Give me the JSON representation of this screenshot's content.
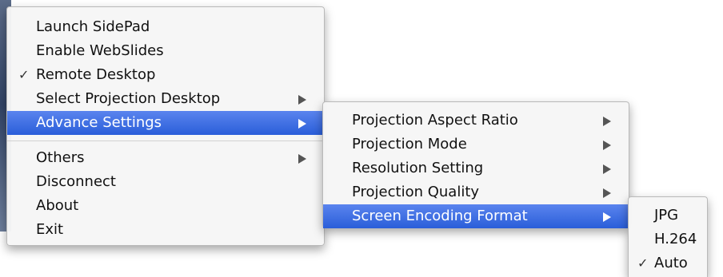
{
  "main_menu": {
    "items": [
      {
        "label": "Launch SidePad"
      },
      {
        "label": "Enable WebSlides"
      },
      {
        "label": "Remote Desktop",
        "checked": true
      },
      {
        "label": "Select Projection Desktop",
        "submenu": true
      },
      {
        "label": "Advance Settings",
        "submenu": true,
        "selected": true
      },
      {
        "label": "Others",
        "submenu": true
      },
      {
        "label": "Disconnect"
      },
      {
        "label": "About"
      },
      {
        "label": "Exit"
      }
    ]
  },
  "advance_menu": {
    "items": [
      {
        "label": "Projection Aspect Ratio",
        "submenu": true
      },
      {
        "label": "Projection Mode",
        "submenu": true
      },
      {
        "label": "Resolution Setting",
        "submenu": true
      },
      {
        "label": "Projection Quality",
        "submenu": true
      },
      {
        "label": "Screen Encoding Format",
        "submenu": true,
        "selected": true
      }
    ]
  },
  "encoding_menu": {
    "items": [
      {
        "label": "JPG"
      },
      {
        "label": "H.264"
      },
      {
        "label": "Auto",
        "checked": true
      }
    ]
  },
  "icons": {
    "check": "✓",
    "submenu_arrow": "triangle-right-icon"
  },
  "colors": {
    "highlight": "#3a6ee0",
    "menu_bg": "#f6f6f6"
  }
}
